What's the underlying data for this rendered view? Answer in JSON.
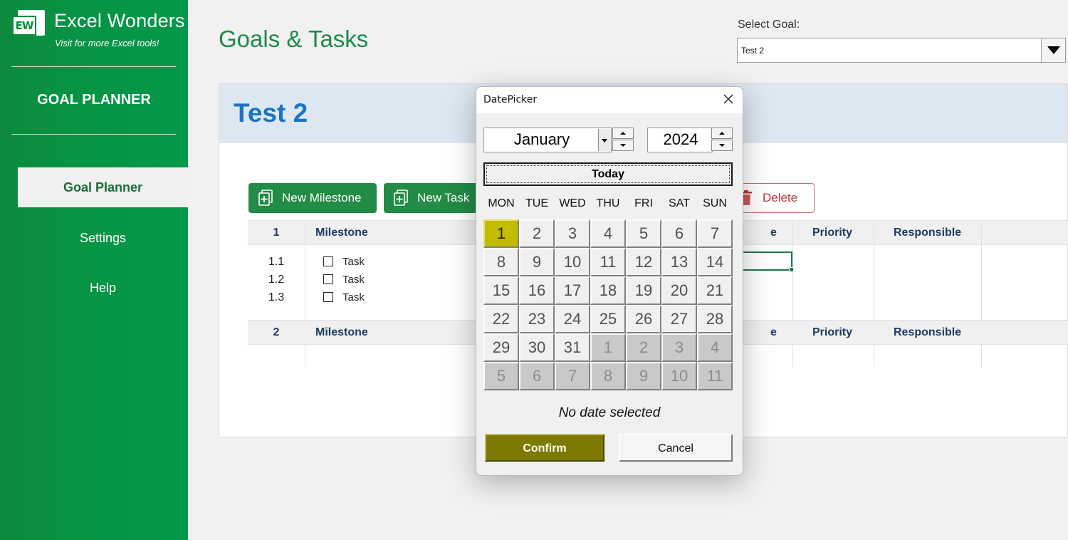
{
  "brand": {
    "logo_text": "EW",
    "name": "Excel Wonders",
    "tagline": "Visit for more Excel tools!"
  },
  "sidebar": {
    "title": "GOAL PLANNER",
    "items": [
      {
        "label": "Goal Planner",
        "active": true
      },
      {
        "label": "Settings",
        "active": false
      },
      {
        "label": "Help",
        "active": false
      }
    ]
  },
  "header": {
    "title": "Goals & Tasks",
    "select_label": "Select Goal:",
    "select_value": "Test 2"
  },
  "panel": {
    "goal_name": "Test 2",
    "buttons": {
      "new_milestone": "New Milestone",
      "new_task": "New Task",
      "delete": "Delete"
    },
    "milestones": [
      {
        "num": "1",
        "label": "Milestone",
        "partial_col": "e",
        "priority": "Priority",
        "responsible": "Responsible",
        "tasks": [
          {
            "num": "1.1",
            "label": "Task"
          },
          {
            "num": "1.2",
            "label": "Task"
          },
          {
            "num": "1.3",
            "label": "Task"
          }
        ]
      },
      {
        "num": "2",
        "label": "Milestone",
        "partial_col": "e",
        "priority": "Priority",
        "responsible": "Responsible",
        "tasks": []
      }
    ]
  },
  "datepicker": {
    "title": "DatePicker",
    "month": "January",
    "year": "2024",
    "today_label": "Today",
    "weekdays": [
      "MON",
      "TUE",
      "WED",
      "THU",
      "FRI",
      "SAT",
      "SUN"
    ],
    "days": [
      [
        1,
        2,
        3,
        4,
        5,
        6,
        7
      ],
      [
        8,
        9,
        10,
        11,
        12,
        13,
        14
      ],
      [
        15,
        16,
        17,
        18,
        19,
        20,
        21
      ],
      [
        22,
        23,
        24,
        25,
        26,
        27,
        28
      ],
      [
        29,
        30,
        31,
        1,
        2,
        3,
        4
      ],
      [
        5,
        6,
        7,
        8,
        9,
        10,
        11
      ]
    ],
    "current_month_days": 31,
    "selected_day": 1,
    "status": "No date selected",
    "confirm_label": "Confirm",
    "cancel_label": "Cancel",
    "colors": {
      "selected": "#c4bc00",
      "confirm": "#7c7a00"
    }
  },
  "colors": {
    "sidebar": "#079344",
    "accent_blue": "#1d72c2",
    "title_green": "#1e8a48"
  }
}
